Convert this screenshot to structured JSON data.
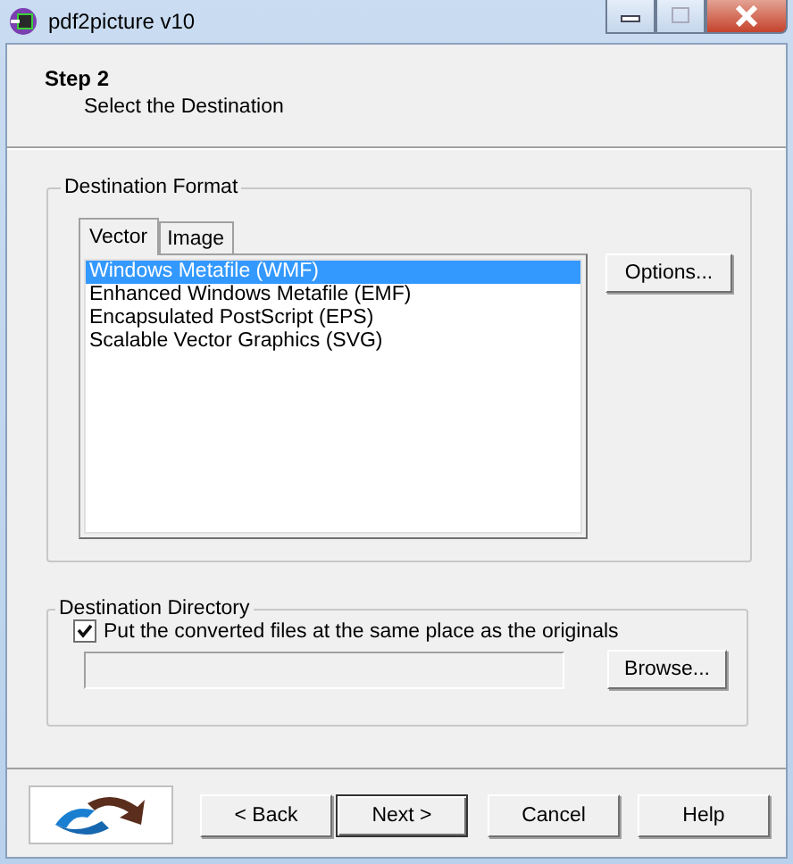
{
  "window": {
    "title": "pdf2picture v10"
  },
  "header": {
    "step": "Step 2",
    "subtitle": "Select the Destination"
  },
  "format_group": {
    "label": "Destination Format",
    "tabs": [
      {
        "label": "Vector",
        "selected": true
      },
      {
        "label": "Image",
        "selected": false
      }
    ],
    "formats": [
      {
        "label": "Windows Metafile (WMF)",
        "selected": true
      },
      {
        "label": "Enhanced Windows Metafile (EMF)",
        "selected": false
      },
      {
        "label": "Encapsulated PostScript (EPS)",
        "selected": false
      },
      {
        "label": "Scalable Vector Graphics (SVG)",
        "selected": false
      }
    ],
    "options_button": "Options..."
  },
  "directory_group": {
    "label": "Destination Directory",
    "same_place": {
      "label": "Put the converted files at the same place as the originals",
      "checked": true
    },
    "path_disabled": true,
    "browse_button": "Browse..."
  },
  "buttons": [
    {
      "label": "< Back",
      "kind": "normal"
    },
    {
      "label": "Next >",
      "kind": "default"
    },
    {
      "label": "Cancel",
      "kind": "normal"
    },
    {
      "label": "Help",
      "kind": "normal"
    }
  ]
}
